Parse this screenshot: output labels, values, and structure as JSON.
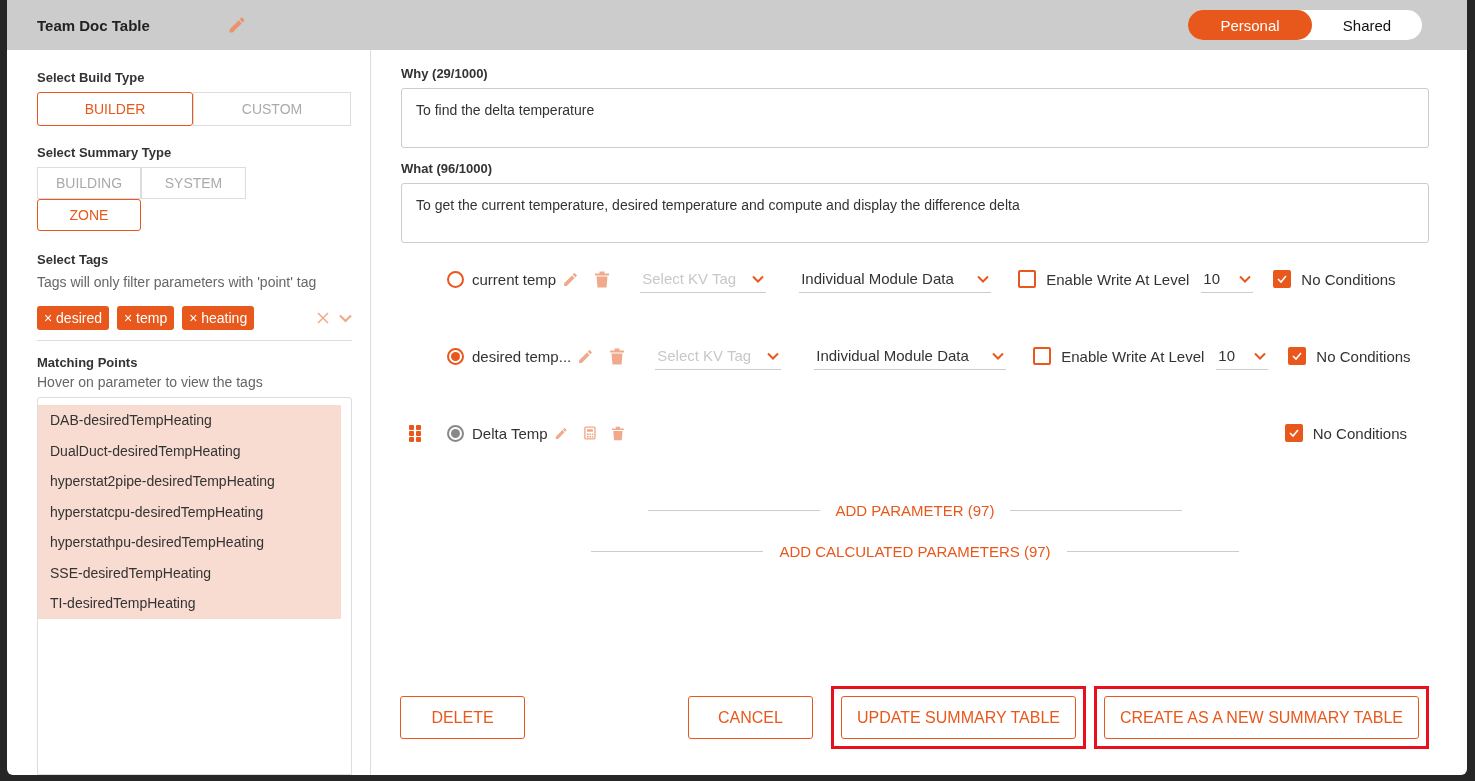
{
  "dialog": {
    "title": "Team Doc Table",
    "scope_toggle": [
      {
        "label": "Personal",
        "selected": true
      },
      {
        "label": "Shared",
        "selected": false
      }
    ]
  },
  "build_type": {
    "label": "Select Build Type",
    "options": [
      {
        "label": "BUILDER",
        "selected": true
      },
      {
        "label": "CUSTOM",
        "selected": false
      }
    ]
  },
  "summary_type": {
    "label": "Select Summary Type",
    "options": [
      {
        "label": "BUILDING",
        "selected": false
      },
      {
        "label": "SYSTEM",
        "selected": false
      },
      {
        "label": "ZONE",
        "selected": true
      }
    ]
  },
  "tags": {
    "label": "Select Tags",
    "hint": "Tags will only filter parameters with 'point' tag",
    "chips": [
      {
        "remove": "×",
        "label": "desired"
      },
      {
        "remove": "×",
        "label": "temp"
      },
      {
        "remove": "×",
        "label": "heating"
      }
    ]
  },
  "matching_points": {
    "label": "Matching Points",
    "hint": "Hover on parameter to view the tags",
    "items": [
      "DAB-desiredTempHeating",
      "DualDuct-desiredTempHeating",
      "hyperstat2pipe-desiredTempHeating",
      "hyperstatcpu-desiredTempHeating",
      "hyperstathpu-desiredTempHeating",
      "SSE-desiredTempHeating",
      "TI-desiredTempHeating"
    ]
  },
  "why": {
    "label": "Why (29/1000)",
    "value": "To find the delta temperature"
  },
  "what": {
    "label": "What (96/1000)",
    "value": "To get the current temperature, desired temperature and compute and display the difference delta"
  },
  "parameters": [
    {
      "kind": "point",
      "name": "current temp",
      "selected": false,
      "kv_tag_placeholder": "Select KV Tag",
      "data_source": "Individual Module Data",
      "enable_write": false,
      "write_label": "Enable Write At Level",
      "write_level": "10",
      "no_conditions": true,
      "conditions_label": "No Conditions"
    },
    {
      "kind": "point",
      "name": "desired temp...",
      "selected": true,
      "kv_tag_placeholder": "Select KV Tag",
      "data_source": "Individual Module Data",
      "enable_write": false,
      "write_label": "Enable Write At Level",
      "write_level": "10",
      "no_conditions": true,
      "conditions_label": "No Conditions"
    },
    {
      "kind": "calculated",
      "name": "Delta Temp",
      "selected": true,
      "no_conditions": true,
      "conditions_label": "No Conditions"
    }
  ],
  "add_links": [
    "ADD PARAMETER (97)",
    "ADD CALCULATED PARAMETERS (97)"
  ],
  "actions": [
    {
      "label": "DELETE",
      "highlighted": false
    },
    {
      "label": "CANCEL",
      "highlighted": false
    },
    {
      "label": "UPDATE SUMMARY TABLE",
      "highlighted": true
    },
    {
      "label": "CREATE AS A NEW SUMMARY TABLE",
      "highlighted": true
    }
  ]
}
